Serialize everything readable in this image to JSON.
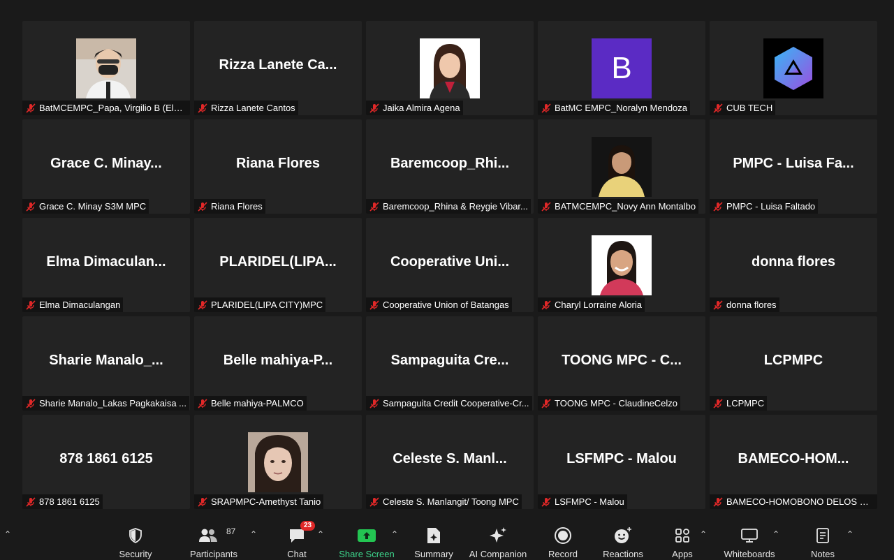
{
  "tiles": [
    {
      "display": "",
      "tag": "BatMCEMPC_Papa, Virgilio B (Elect...",
      "photo": "person-mask"
    },
    {
      "display": "Rizza  Lanete  Ca...",
      "tag": "Rizza Lanete Cantos",
      "photo": ""
    },
    {
      "display": "",
      "tag": "Jaika Almira Agena",
      "photo": "person-woman-1"
    },
    {
      "display": "",
      "tag": "BatMC EMPC_Noralyn Mendoza",
      "photo": "letter-b"
    },
    {
      "display": "",
      "tag": "CUB TECH",
      "photo": "logo-cube"
    },
    {
      "display": "Grace  C.  Minay...",
      "tag": "Grace C. Minay S3M MPC",
      "photo": ""
    },
    {
      "display": "Riana Flores",
      "tag": "Riana Flores",
      "photo": ""
    },
    {
      "display": "Baremcoop_Rhi...",
      "tag": "Baremcoop_Rhina & Reygie Vibar...",
      "photo": ""
    },
    {
      "display": "",
      "tag": "BATMCEMPC_Novy Ann Montalbo",
      "photo": "person-woman-2"
    },
    {
      "display": "PMPC  -  Luisa  Fa...",
      "tag": "PMPC - Luisa Faltado",
      "photo": ""
    },
    {
      "display": "Elma  Dimaculan...",
      "tag": "Elma Dimaculangan",
      "photo": ""
    },
    {
      "display": "PLARIDEL(LIPA...",
      "tag": "PLARIDEL(LIPA CITY)MPC",
      "photo": ""
    },
    {
      "display": "Cooperative  Uni...",
      "tag": "Cooperative Union of Batangas",
      "photo": ""
    },
    {
      "display": "",
      "tag": "Charyl Lorraine Aloria",
      "photo": "person-woman-3"
    },
    {
      "display": "donna flores",
      "tag": "donna flores",
      "photo": ""
    },
    {
      "display": "Sharie  Manalo_...",
      "tag": "Sharie Manalo_Lakas Pagkakaisa ...",
      "photo": ""
    },
    {
      "display": "Belle  mahiya-P...",
      "tag": "Belle mahiya-PALMCO",
      "photo": ""
    },
    {
      "display": "Sampaguita  Cre...",
      "tag": "Sampaguita Credit Cooperative-Cr...",
      "photo": ""
    },
    {
      "display": "TOONG  MPC  -  C...",
      "tag": "TOONG MPC - ClaudineCelzo",
      "photo": ""
    },
    {
      "display": "LCPMPC",
      "tag": "LCPMPC",
      "photo": ""
    },
    {
      "display": "878 1861 6125",
      "tag": "878 1861 6125",
      "photo": ""
    },
    {
      "display": "",
      "tag": "SRAPMPC-Amethyst Tanio",
      "photo": "person-woman-4"
    },
    {
      "display": "Celeste  S.  Manl...",
      "tag": "Celeste S. Manlangit/ Toong MPC",
      "photo": ""
    },
    {
      "display": "LSFMPC - Malou",
      "tag": "LSFMPC - Malou",
      "photo": ""
    },
    {
      "display": "BAMECO-HOM...",
      "tag": "BAMECO-HOMOBONO DELOS RE...",
      "photo": ""
    }
  ],
  "letter_avatar": "B",
  "toolbar": {
    "security": "Security",
    "participants": "Participants",
    "participants_count": "87",
    "chat": "Chat",
    "chat_badge": "23",
    "share_screen": "Share Screen",
    "summary": "Summary",
    "ai_companion": "AI Companion",
    "record": "Record",
    "reactions": "Reactions",
    "apps": "Apps",
    "whiteboards": "Whiteboards",
    "notes": "Notes"
  },
  "colors": {
    "tile_bg": "#232323",
    "page_bg": "#1a1a1a",
    "muted_red": "#e02828",
    "share_green": "#23c552",
    "letter_avatar_bg": "#5b2bc4"
  }
}
